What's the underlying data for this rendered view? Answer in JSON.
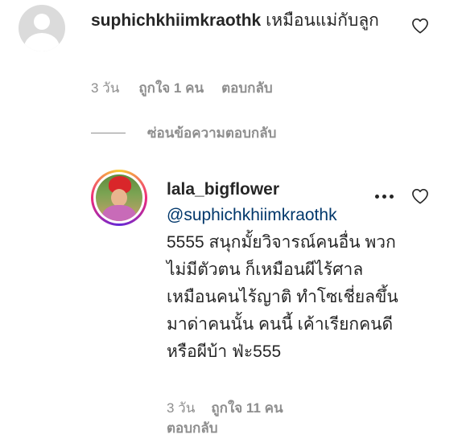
{
  "comment": {
    "username": "suphichkhiimkraothk",
    "text": "เหมือนแม่กับลูก",
    "time": "3 วัน",
    "likes": "ถูกใจ 1 คน",
    "reply_label": "ตอบกลับ",
    "avatar_icon": "default-avatar-icon",
    "like_icon": "heart-outline-icon"
  },
  "hide_replies_label": "ซ่อนข้อความตอบกลับ",
  "reply": {
    "username": "lala_bigflower",
    "mention": "@suphichkhiimkraothk",
    "text": "5555 สนุกมั้ยวิจารณ์คนอื่น พวกไม่มีตัวตน ก็เหมือนผีไร้ศาล เหมือนคนไร้ญาติ ทำโซเชี่ยลขึ้นมาด่าคนนั้น คนนี้ เค้าเรียกคนดีหรือผีบ้า ฟ่ะ555",
    "time": "3 วัน",
    "likes": "ถูกใจ 11 คน",
    "reply_label": "ตอบกลับ",
    "more_icon": "more-options-icon",
    "like_icon": "heart-outline-icon"
  },
  "colors": {
    "text": "#262626",
    "secondary": "#8e8e8e",
    "mention": "#00376b",
    "story_ring": [
      "#f9ce34",
      "#ee2a7b",
      "#6228d7"
    ]
  }
}
